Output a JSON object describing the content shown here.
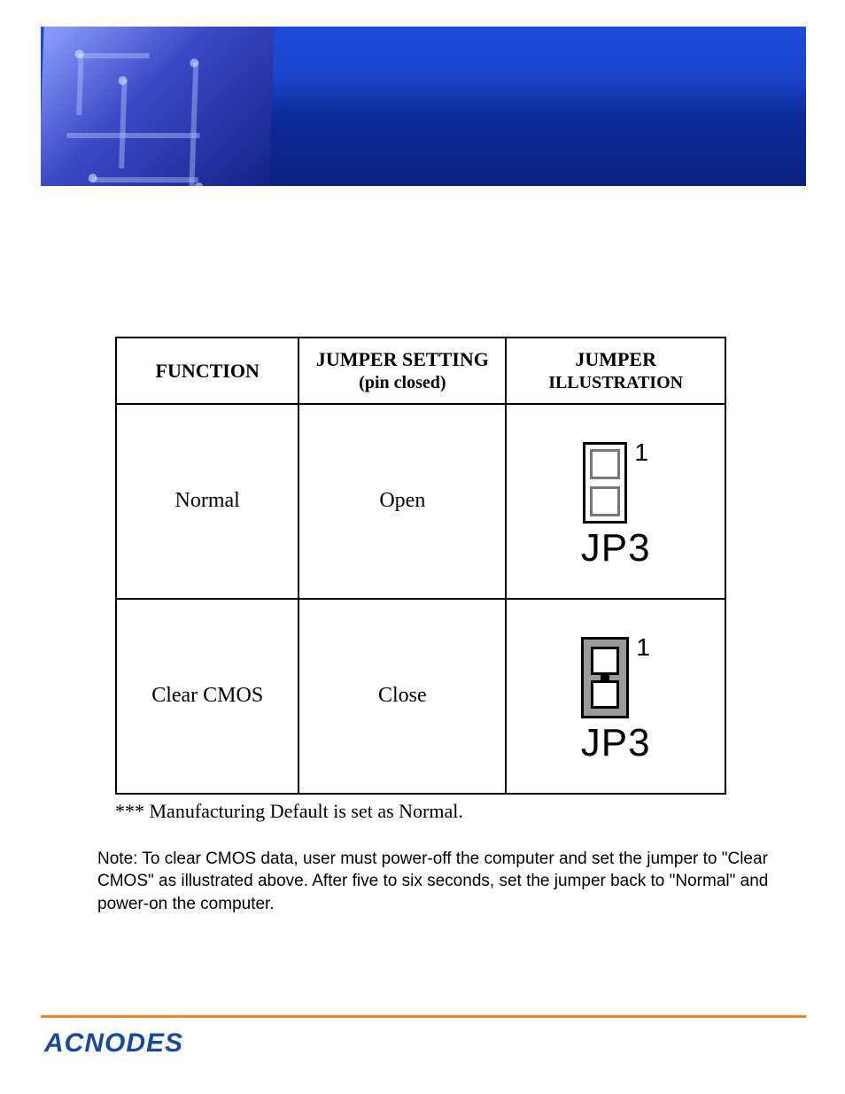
{
  "table": {
    "headers": {
      "function": "FUNCTION",
      "setting": "JUMPER SETTING",
      "setting_sub": "(pin closed)",
      "illustration": "JUMPER",
      "illustration_sub": "ILLUSTRATION"
    },
    "rows": [
      {
        "function": "Normal",
        "setting": "Open",
        "pin1": "1",
        "jp": "JP3"
      },
      {
        "function": "Clear CMOS",
        "setting": "Close",
        "pin1": "1",
        "jp": "JP3"
      }
    ]
  },
  "default_note": "*** Manufacturing Default is set as Normal.",
  "cmos_note": "Note: To clear CMOS data, user must power-off the computer and set the jumper to \"Clear CMOS\" as illustrated above.   After five to six seconds, set the jumper back to \"Normal\" and power-on the computer.",
  "brand": "ACNODES"
}
